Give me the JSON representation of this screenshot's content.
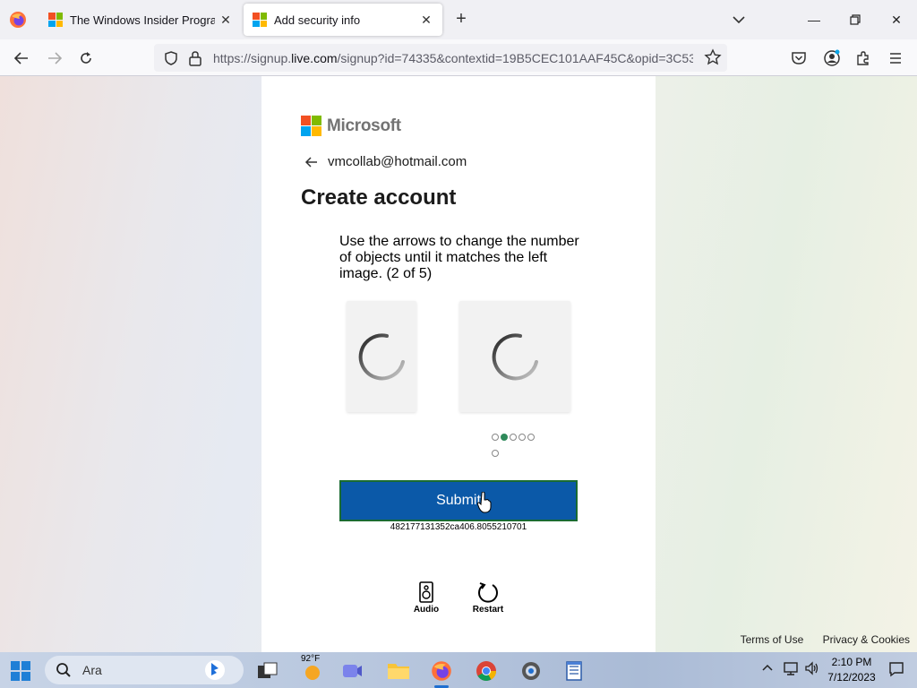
{
  "browser": {
    "tabs": [
      {
        "title": "The Windows Insider Program",
        "active": false
      },
      {
        "title": "Add security info",
        "active": true
      }
    ],
    "url_host_prefix": "https://signup.",
    "url_domain": "live.com",
    "url_rest": "/signup?id=74335&contextid=19B5CEC101AAF45C&opid=3C53"
  },
  "page": {
    "brand": "Microsoft",
    "email": "vmcollab@hotmail.com",
    "heading": "Create account",
    "instructions": "Use the arrows to change the number of objects until it matches the left image. (2 of 5)",
    "submit_label": "Submit",
    "session_id": "482177131352ca406.8055210701",
    "audio_label": "Audio",
    "restart_label": "Restart",
    "progress": {
      "current": 2,
      "total": 5,
      "extra_dot": true
    }
  },
  "footer": {
    "terms": "Terms of Use",
    "privacy": "Privacy & Cookies"
  },
  "taskbar": {
    "search_placeholder": "Ara",
    "weather_temp": "92°F",
    "time": "2:10 PM",
    "date": "7/12/2023"
  },
  "colors": {
    "ms_red": "#f25022",
    "ms_green": "#7fba00",
    "ms_blue": "#00a4ef",
    "ms_yellow": "#ffb900",
    "submit_bg": "#0b59a8",
    "active_dot": "#2f8a5a"
  }
}
